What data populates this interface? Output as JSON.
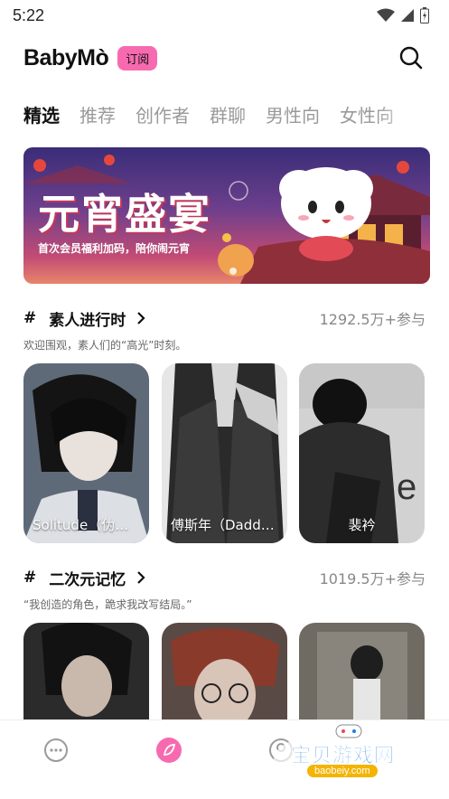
{
  "status_bar": {
    "time": "5:22",
    "icons": [
      "wifi-icon",
      "cell-signal-icon",
      "battery-icon"
    ]
  },
  "header": {
    "logo": "BabyMò",
    "subscribe_label": "订阅",
    "search_icon": "search-icon"
  },
  "tabs": [
    "精选",
    "推荐",
    "创作者",
    "群聊",
    "男性向",
    "女性向"
  ],
  "active_tab": "精选",
  "banner": {
    "title": "元宵盛宴",
    "subtitle": "首次会员福利加码，陪你闹元宵"
  },
  "sections": [
    {
      "hash": "#",
      "title": "素人进行时",
      "participants": "1292.5万+参与",
      "description": "欢迎围观，素人们的“高光”时刻。",
      "cards": [
        {
          "label": "Solitude（伪骨..."
        },
        {
          "label": "傅斯年（Daddy）"
        },
        {
          "label": "裴衿"
        }
      ]
    },
    {
      "hash": "#",
      "title": "二次元记忆",
      "participants": "1019.5万+参与",
      "description": "“我创造的角色，跪求我改写结局。”",
      "cards": [
        {
          "label": ""
        },
        {
          "label": ""
        },
        {
          "label": ""
        }
      ]
    }
  ],
  "bottom_nav": [
    "chat-icon",
    "discover-icon",
    "profile-icon"
  ],
  "colors": {
    "accent_pink": "#f76ab0",
    "muted_text": "#9a9a9a"
  },
  "watermark": {
    "text": "宝贝游戏网",
    "url": "baobeiy.com"
  }
}
